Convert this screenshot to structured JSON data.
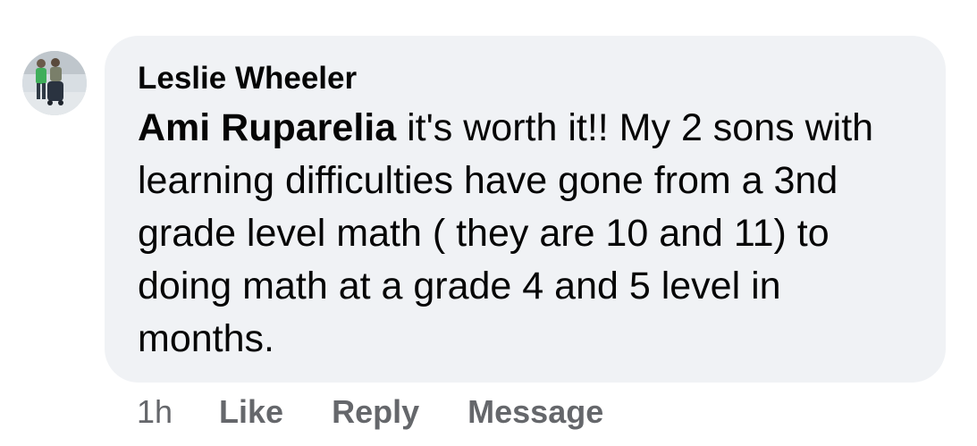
{
  "comment": {
    "author": "Leslie Wheeler",
    "mention": "Ami Ruparelia",
    "text": " it's worth it!! My 2 sons with learning difficulties have gone from a 3nd grade level math ( they are 10 and 11) to doing math at a grade 4 and 5 level in months.",
    "timestamp": "1h",
    "actions": {
      "like": "Like",
      "reply": "Reply",
      "message": "Message"
    }
  },
  "colors": {
    "bubble_background": "#f0f2f5",
    "secondary_text": "#65676b",
    "primary_text": "#050505"
  }
}
